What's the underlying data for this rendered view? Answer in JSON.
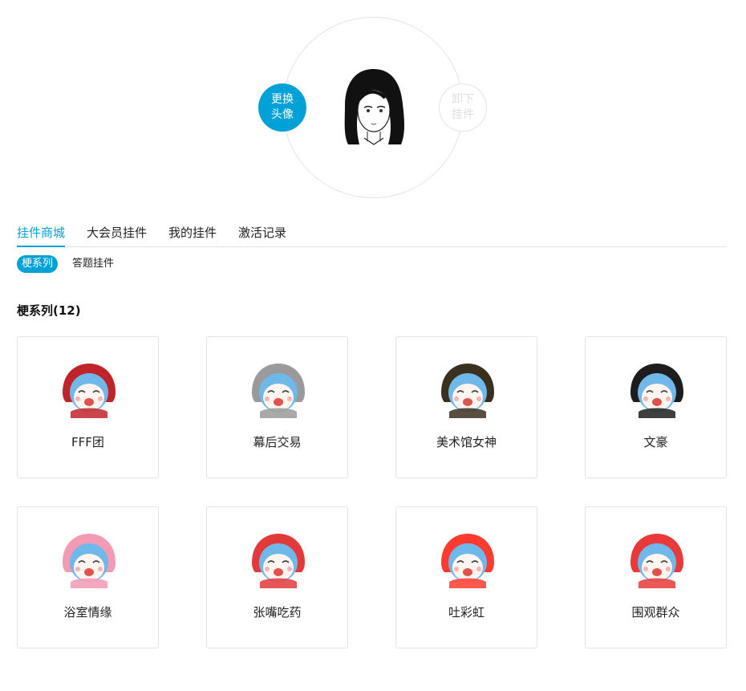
{
  "avatar": {
    "change_label": [
      "更换",
      "头像"
    ],
    "remove_label": [
      "卸下",
      "挂件"
    ]
  },
  "tabs": [
    {
      "label": "挂件商城",
      "active": true
    },
    {
      "label": "大会员挂件",
      "active": false
    },
    {
      "label": "我的挂件",
      "active": false
    },
    {
      "label": "激活记录",
      "active": false
    }
  ],
  "subtabs": [
    {
      "label": "梗系列",
      "active": true
    },
    {
      "label": "答题挂件",
      "active": false
    }
  ],
  "section": {
    "title": "梗系列(12)"
  },
  "items": [
    {
      "name": "FFF团",
      "icon": "fff-hood-pendant-icon",
      "accent": "#c0242b"
    },
    {
      "name": "幕后交易",
      "icon": "beethoven-wig-pendant-icon",
      "accent": "#9a9a9a"
    },
    {
      "name": "美术馆女神",
      "icon": "mona-lisa-pendant-icon",
      "accent": "#3b3020"
    },
    {
      "name": "文豪",
      "icon": "writer-hair-pendant-icon",
      "accent": "#1d1d1d"
    },
    {
      "name": "浴室情缘",
      "icon": "bathroom-shower-pendant-icon",
      "accent": "#f39ab5"
    },
    {
      "name": "张嘴吃药",
      "icon": "pill-pendant-icon",
      "accent": "#e23a3a"
    },
    {
      "name": "吐彩虹",
      "icon": "rainbow-pendant-icon",
      "accent": "#ff3b30"
    },
    {
      "name": "围观群众",
      "icon": "watermelon-pendant-icon",
      "accent": "#e83a3a"
    }
  ],
  "colors": {
    "accent": "#00a1d6",
    "border": "#e3e3e3",
    "face_hair": "#6fb8ea"
  }
}
